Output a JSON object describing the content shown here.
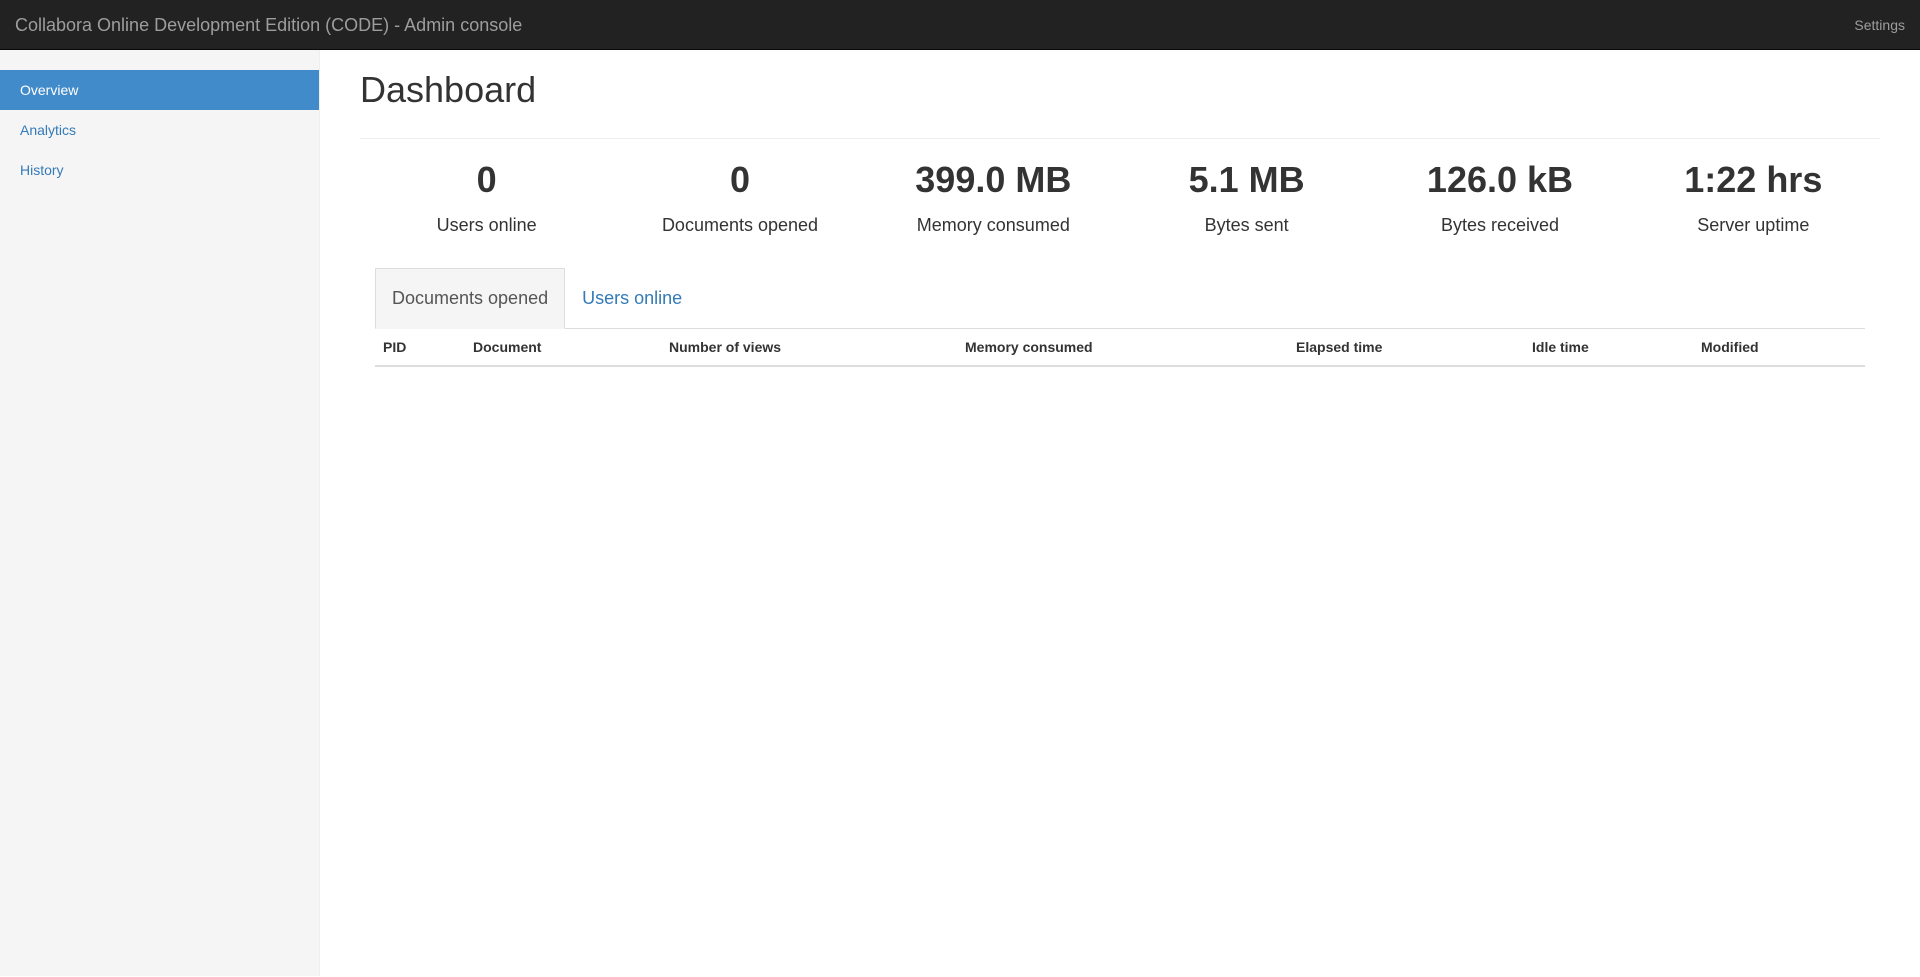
{
  "navbar": {
    "brand": "Collabora Online Development Edition (CODE) - Admin console",
    "settings": "Settings"
  },
  "sidebar": {
    "items": [
      {
        "label": "Overview",
        "active": true
      },
      {
        "label": "Analytics",
        "active": false
      },
      {
        "label": "History",
        "active": false
      }
    ]
  },
  "main": {
    "title": "Dashboard",
    "stats": [
      {
        "value": "0",
        "label": "Users online"
      },
      {
        "value": "0",
        "label": "Documents opened"
      },
      {
        "value": "399.0 MB",
        "label": "Memory consumed"
      },
      {
        "value": "5.1 MB",
        "label": "Bytes sent"
      },
      {
        "value": "126.0 kB",
        "label": "Bytes received"
      },
      {
        "value": "1:22 hrs",
        "label": "Server uptime"
      }
    ],
    "tabs": [
      {
        "label": "Documents opened",
        "active": true
      },
      {
        "label": "Users online",
        "active": false
      }
    ],
    "table": {
      "columns": [
        "PID",
        "Document",
        "Number of views",
        "Memory consumed",
        "Elapsed time",
        "Idle time",
        "Modified"
      ],
      "rows": []
    }
  },
  "colors": {
    "navbar_bg": "#222222",
    "accent": "#428bca",
    "link": "#337ab7",
    "sidebar_bg": "#f5f5f5"
  }
}
